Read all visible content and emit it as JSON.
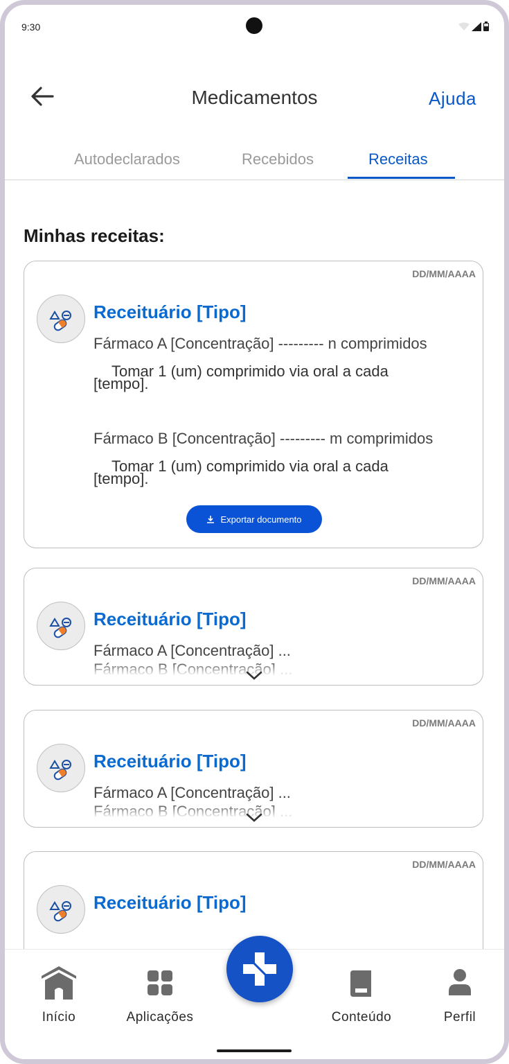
{
  "status": {
    "time": "9:30"
  },
  "header": {
    "title": "Medicamentos",
    "help": "Ajuda"
  },
  "tabs": [
    {
      "label": "Autodeclarados"
    },
    {
      "label": "Recebidos"
    },
    {
      "label": "Receitas"
    }
  ],
  "section": {
    "title": "Minhas receitas:"
  },
  "cards": [
    {
      "date": "DD/MM/AAAA",
      "title": "Receituário [Tipo]",
      "items": [
        {
          "drug": "Fármaco A [Concentração] --------- n comprimidos",
          "instruction": "Tomar 1 (um) comprimido via oral a cada [tempo]."
        },
        {
          "drug": "Fármaco B [Concentração] --------- m comprimidos",
          "instruction": "Tomar 1 (um) comprimido via oral a cada [tempo]."
        }
      ],
      "export_label": "Exportar documento"
    },
    {
      "date": "DD/MM/AAAA",
      "title": "Receituário [Tipo]",
      "line1": "Fármaco A [Concentração] ...",
      "line2": "Fármaco B [Concentração] ..."
    },
    {
      "date": "DD/MM/AAAA",
      "title": "Receituário [Tipo]",
      "line1": "Fármaco A [Concentração] ...",
      "line2": "Fármaco B [Concentração] ..."
    },
    {
      "date": "DD/MM/AAAA",
      "title": "Receituário [Tipo]"
    }
  ],
  "nav": [
    {
      "label": "Início",
      "icon": "home-icon"
    },
    {
      "label": "Aplicações",
      "icon": "apps-grid-icon"
    },
    {
      "label": "Conteúdo",
      "icon": "book-icon"
    },
    {
      "label": "Perfil",
      "icon": "person-icon"
    }
  ],
  "colors": {
    "primary": "#0a57c8",
    "fab": "#1552c5",
    "title_blue": "#0a6ad0"
  }
}
